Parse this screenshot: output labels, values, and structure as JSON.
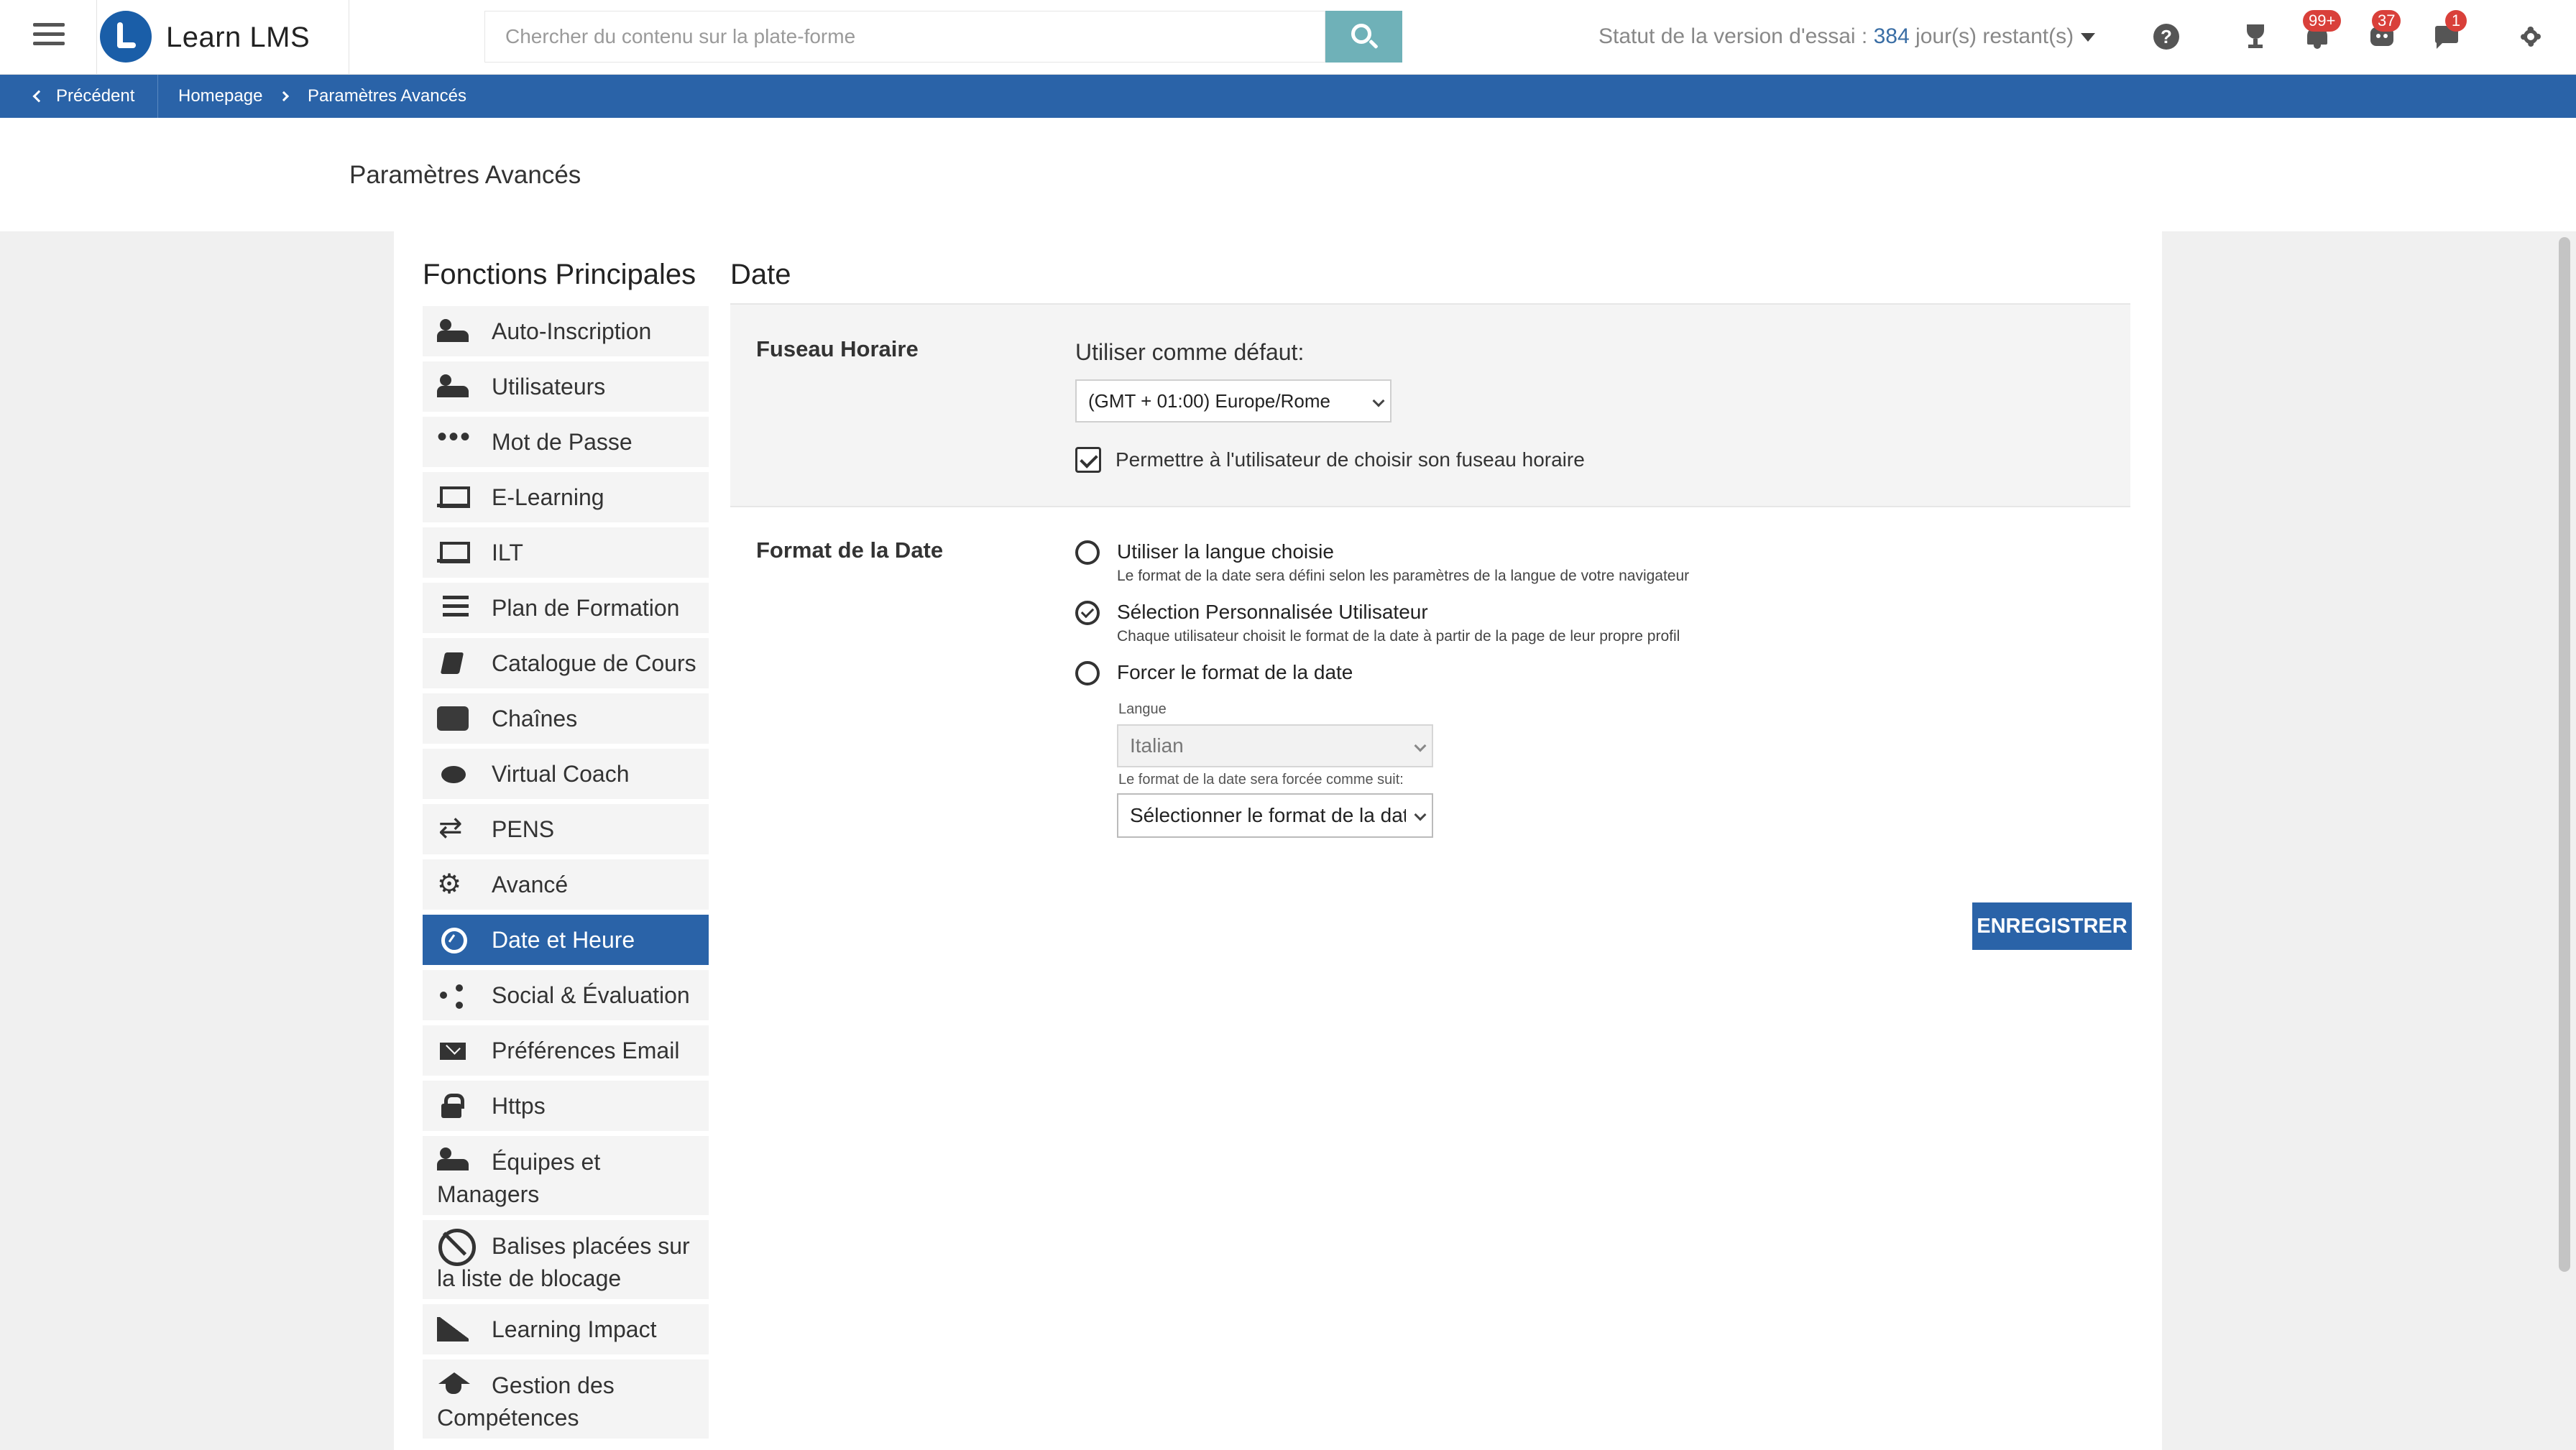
{
  "app": {
    "name": "Learn LMS"
  },
  "search": {
    "placeholder": "Chercher du contenu sur la plate-forme"
  },
  "trial": {
    "prefix": "Statut de la version d'essai :",
    "days": "384",
    "suffix": "jour(s) restant(s)"
  },
  "badges": {
    "notifications": "99+",
    "robot": "37",
    "chat": "1"
  },
  "breadcrumb": {
    "back": "Précédent",
    "home": "Homepage",
    "current": "Paramètres Avancés"
  },
  "page": {
    "title": "Paramètres Avancés"
  },
  "sidebar": {
    "heading": "Fonctions Principales",
    "items": [
      {
        "label": "Auto-Inscription",
        "icon": "user-plus-icon"
      },
      {
        "label": "Utilisateurs",
        "icon": "users-icon"
      },
      {
        "label": "Mot de Passe",
        "icon": "dots-icon"
      },
      {
        "label": "E-Learning",
        "icon": "laptop-icon"
      },
      {
        "label": "ILT",
        "icon": "presentation-icon"
      },
      {
        "label": "Plan de Formation",
        "icon": "list-icon"
      },
      {
        "label": "Catalogue de Cours",
        "icon": "book-icon"
      },
      {
        "label": "Chaînes",
        "icon": "channels-icon"
      },
      {
        "label": "Virtual Coach",
        "icon": "chat-bubble-icon"
      },
      {
        "label": "PENS",
        "icon": "arrows-icon"
      },
      {
        "label": "Avancé",
        "icon": "gears-icon"
      },
      {
        "label": "Date et Heure",
        "icon": "clock-icon"
      },
      {
        "label": "Social & Évaluation",
        "icon": "share-icon"
      },
      {
        "label": "Préférences Email",
        "icon": "mail-icon"
      },
      {
        "label": "Https",
        "icon": "lock-icon"
      },
      {
        "label": "Équipes et Managers",
        "icon": "team-icon"
      },
      {
        "label": "Balises placées sur la liste de blocage",
        "icon": "block-icon"
      },
      {
        "label": "Learning Impact",
        "icon": "area-chart-icon"
      },
      {
        "label": "Gestion des Compétences",
        "icon": "graduation-cap-icon"
      }
    ]
  },
  "content": {
    "section_title": "Date",
    "timezone": {
      "label": "Fuseau Horaire",
      "default_label": "Utiliser comme défaut:",
      "selected": "(GMT + 01:00) Europe/Rome",
      "allow_user_label": "Permettre à l'utilisateur de choisir son fuseau horaire",
      "allow_user_checked": true
    },
    "date_format": {
      "label": "Format de la Date",
      "options": [
        {
          "label": "Utiliser la langue choisie",
          "description": "Le format de la date sera défini selon les paramètres de la langue de votre navigateur",
          "checked": false
        },
        {
          "label": "Sélection Personnalisée Utilisateur",
          "description": "Chaque utilisateur choisit le format de la date à partir de la page de leur propre profil",
          "checked": true
        },
        {
          "label": "Forcer le format de la date",
          "description": "",
          "checked": false
        }
      ],
      "language_label": "Langue",
      "language_value": "Italian",
      "forced_label": "Le format de la date sera forcée comme suit:",
      "forced_value": "Sélectionner le format de la date"
    },
    "save_label": "ENREGISTRER"
  }
}
